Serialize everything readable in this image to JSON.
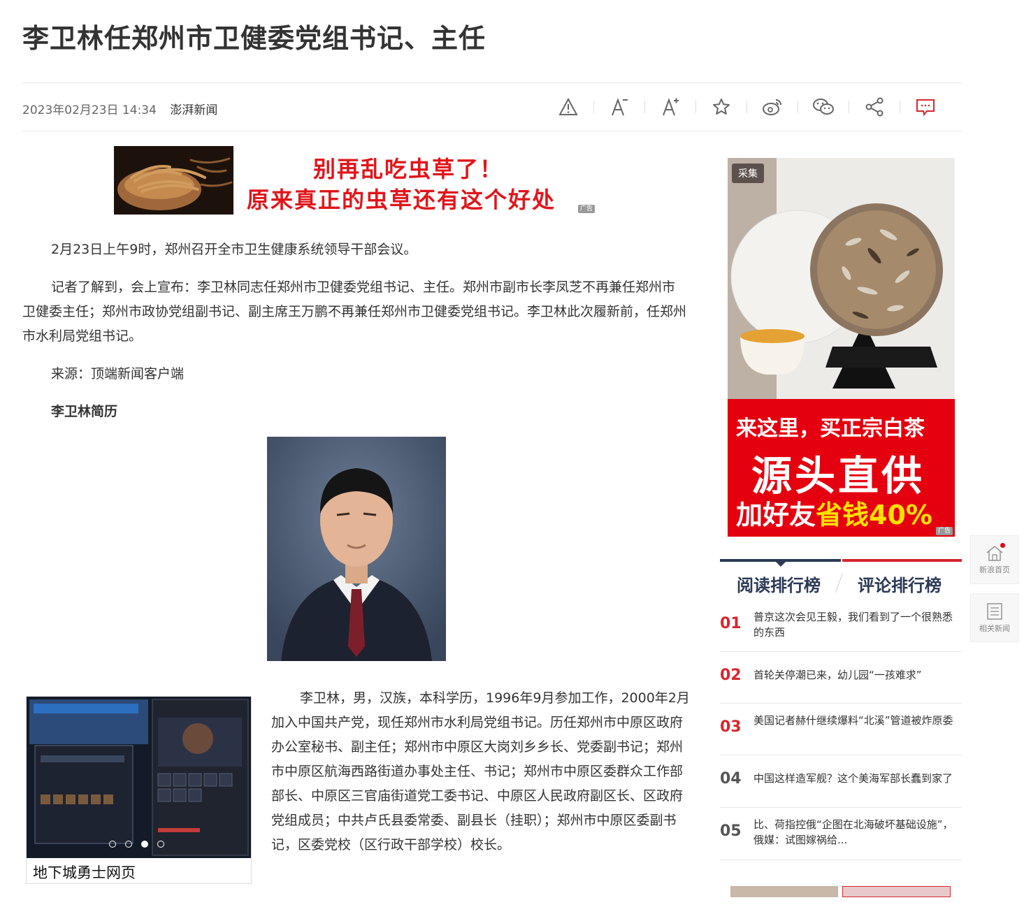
{
  "article": {
    "title": "李卫林任郑州市卫健委党组书记、主任",
    "date": "2023年02月23日 14:34",
    "source": "澎湃新闻",
    "paragraphs": [
      "2月23日上午9时，郑州召开全市卫生健康系统领导干部会议。",
      "记者了解到，会上宣布：李卫林同志任郑州市卫健委党组书记、主任。郑州市副市长李凤芝不再兼任郑州市卫健委主任；郑州市政协党组副书记、副主席王万鹏不再兼任郑州市卫健委党组书记。李卫林此次履新前，任郑州市水利局党组书记。",
      "来源：顶端新闻客户端",
      "李卫林简历"
    ],
    "bio": "李卫林，男，汉族，本科学历，1996年9月参加工作，2000年2月加入中国共产党，现任郑州市水利局党组书记。历任郑州市中原区政府办公室秘书、副主任；郑州市中原区大岗刘乡乡长、党委副书记；郑州市中原区航海西路街道办事处主任、书记；郑州市中原区委群众工作部部长、中原区三官庙街道党工委书记、中原区人民政府副区长、区政府党组成员；中共卢氏县委常委、副县长（挂职）；郑州市中原区委副书记，区委党校（区行政干部学校）校长。"
  },
  "toolbar": {
    "icons": [
      "warning-icon",
      "font-decrease-icon",
      "font-increase-icon",
      "star-icon",
      "weibo-icon",
      "wechat-icon",
      "share-icon",
      "comment-icon"
    ]
  },
  "ads": {
    "top": {
      "line1": "别再乱吃虫草了！",
      "line2": "原来真正的虫草还有这个好处",
      "tag": "广告"
    },
    "side": {
      "badge": "采集",
      "line1": "来这里，买正宗白茶",
      "line2": "源头直供",
      "line3a": "加好友",
      "line3b": "省钱40%",
      "tag": "广告"
    },
    "game": {
      "caption": "地下城勇士网页"
    }
  },
  "ranking": {
    "tab_read": "阅读排行榜",
    "tab_comment": "评论排行榜",
    "items": [
      {
        "num": "01",
        "text": "普京这次会见王毅，我们看到了一个很熟悉的东西"
      },
      {
        "num": "02",
        "text": "首轮关停潮已来，幼儿园“一孩难求”"
      },
      {
        "num": "03",
        "text": "美国记者赫什继续爆料“北溪”管道被炸原委"
      },
      {
        "num": "04",
        "text": "中国这样造军舰？这个美海军部长蠢到家了"
      },
      {
        "num": "05",
        "text": "比、荷指控俄“企图在北海破坏基础设施”，俄媒：试图嫁祸给..."
      }
    ]
  },
  "floating": {
    "home": "新浪首页",
    "related": "相关新闻"
  },
  "colors": {
    "accent_red": "#d8262f",
    "navy": "#2b3a55",
    "ad_red": "#e4000f"
  }
}
